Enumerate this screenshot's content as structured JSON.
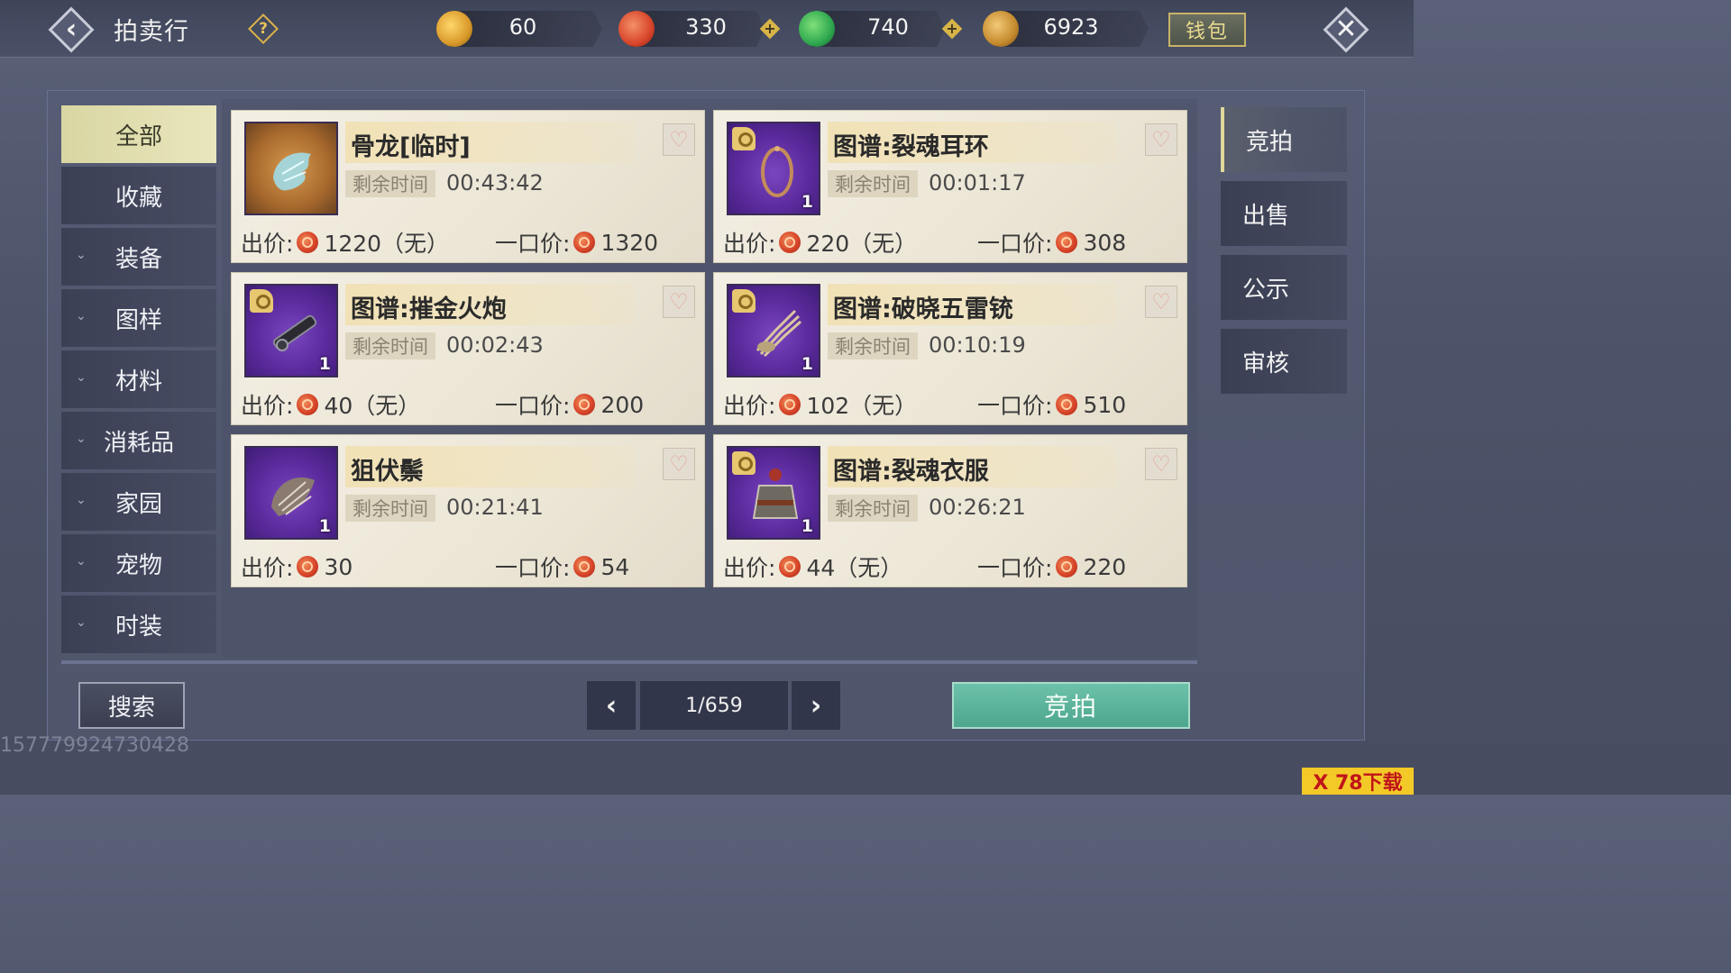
{
  "header": {
    "title": "拍卖行",
    "wallet_label": "钱包",
    "currencies": [
      {
        "icon": "gold-ingot-icon",
        "value": "60",
        "color": "#d99a2a"
      },
      {
        "icon": "red-coin-icon",
        "value": "330",
        "color": "#d8452a"
      },
      {
        "icon": "jade-coin-icon",
        "value": "740",
        "color": "#2fa84f"
      },
      {
        "icon": "copper-shell-icon",
        "value": "6923",
        "color": "#c58a2e"
      }
    ]
  },
  "categories": [
    {
      "label": "全部",
      "expandable": false,
      "active": true
    },
    {
      "label": "收藏",
      "expandable": false
    },
    {
      "label": "装备",
      "expandable": true
    },
    {
      "label": "图样",
      "expandable": true
    },
    {
      "label": "材料",
      "expandable": true
    },
    {
      "label": "消耗品",
      "expandable": true
    },
    {
      "label": "家园",
      "expandable": true
    },
    {
      "label": "宠物",
      "expandable": true
    },
    {
      "label": "时装",
      "expandable": true
    }
  ],
  "tabs": [
    {
      "label": "竞拍",
      "active": true
    },
    {
      "label": "出售"
    },
    {
      "label": "公示"
    },
    {
      "label": "审核"
    }
  ],
  "labels": {
    "time_left": "剩余时间",
    "bid": "出价:",
    "buyout": "一口价:"
  },
  "listings": [
    {
      "name": "骨龙[临时]",
      "time": "00:43:42",
      "bid": "1220（无）",
      "buyout": "1320",
      "rarity": "orange",
      "qty": "",
      "recipe": false,
      "icon": "bone-dragon-icon"
    },
    {
      "name": "图谱:裂魂耳环",
      "time": "00:01:17",
      "bid": "220（无）",
      "buyout": "308",
      "rarity": "purple",
      "qty": "1",
      "recipe": true,
      "icon": "earring-icon"
    },
    {
      "name": "图谱:摧金火炮",
      "time": "00:02:43",
      "bid": "40（无）",
      "buyout": "200",
      "rarity": "purple",
      "qty": "1",
      "recipe": true,
      "icon": "cannon-icon"
    },
    {
      "name": "图谱:破晓五雷铳",
      "time": "00:10:19",
      "bid": "102（无）",
      "buyout": "510",
      "rarity": "purple",
      "qty": "1",
      "recipe": true,
      "icon": "claw-gun-icon"
    },
    {
      "name": "狙伏鬃",
      "time": "00:21:41",
      "bid": "30",
      "buyout": "54",
      "rarity": "purple",
      "qty": "1",
      "recipe": false,
      "icon": "fur-mane-icon"
    },
    {
      "name": "图谱:裂魂衣服",
      "time": "00:26:21",
      "bid": "44（无）",
      "buyout": "220",
      "rarity": "purple",
      "qty": "1",
      "recipe": true,
      "icon": "armor-robe-icon"
    }
  ],
  "footer": {
    "search_label": "搜索",
    "page": "1/659",
    "action_label": "竞拍",
    "uid": "157779924730428"
  },
  "watermark": "X 78下载"
}
